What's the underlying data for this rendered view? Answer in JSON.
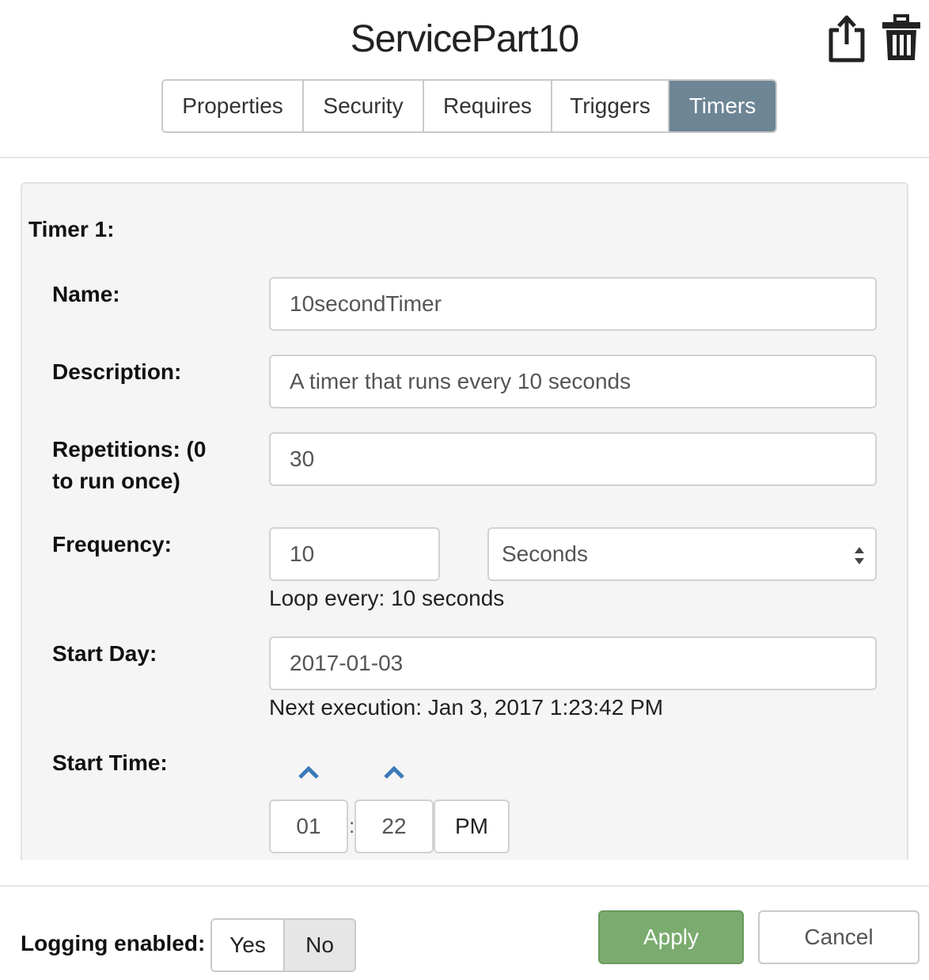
{
  "header": {
    "title": "ServicePart10",
    "share_icon": "share-export-icon",
    "delete_icon": "trash-icon"
  },
  "tabs": [
    {
      "label": "Properties",
      "active": false
    },
    {
      "label": "Security",
      "active": false
    },
    {
      "label": "Requires",
      "active": false
    },
    {
      "label": "Triggers",
      "active": false
    },
    {
      "label": "Timers",
      "active": true
    }
  ],
  "timer": {
    "heading": "Timer 1:",
    "name_label": "Name:",
    "name_value": "10secondTimer",
    "description_label": "Description:",
    "description_value": "A timer that runs every 10 seconds",
    "repetitions_label_line1": "Repetitions: (0",
    "repetitions_label_line2": "to run once)",
    "repetitions_value": "30",
    "frequency_label": "Frequency:",
    "frequency_value": "10",
    "frequency_unit": "Seconds",
    "loop_text": "Loop every: 10 seconds",
    "start_day_label": "Start Day:",
    "start_day_value": "2017-01-03",
    "next_execution_text": "Next execution: Jan 3, 2017 1:23:42 PM",
    "start_time_label": "Start Time:",
    "hour": "01",
    "separator": ":",
    "minute": "22",
    "ampm": "PM"
  },
  "footer": {
    "logging_label": "Logging enabled:",
    "yes_label": "Yes",
    "no_label": "No",
    "selected": "No",
    "apply_label": "Apply",
    "cancel_label": "Cancel"
  },
  "colors": {
    "active_tab": "#6d8595",
    "apply_button": "#7bab6f",
    "chevron": "#3a7ab8"
  }
}
